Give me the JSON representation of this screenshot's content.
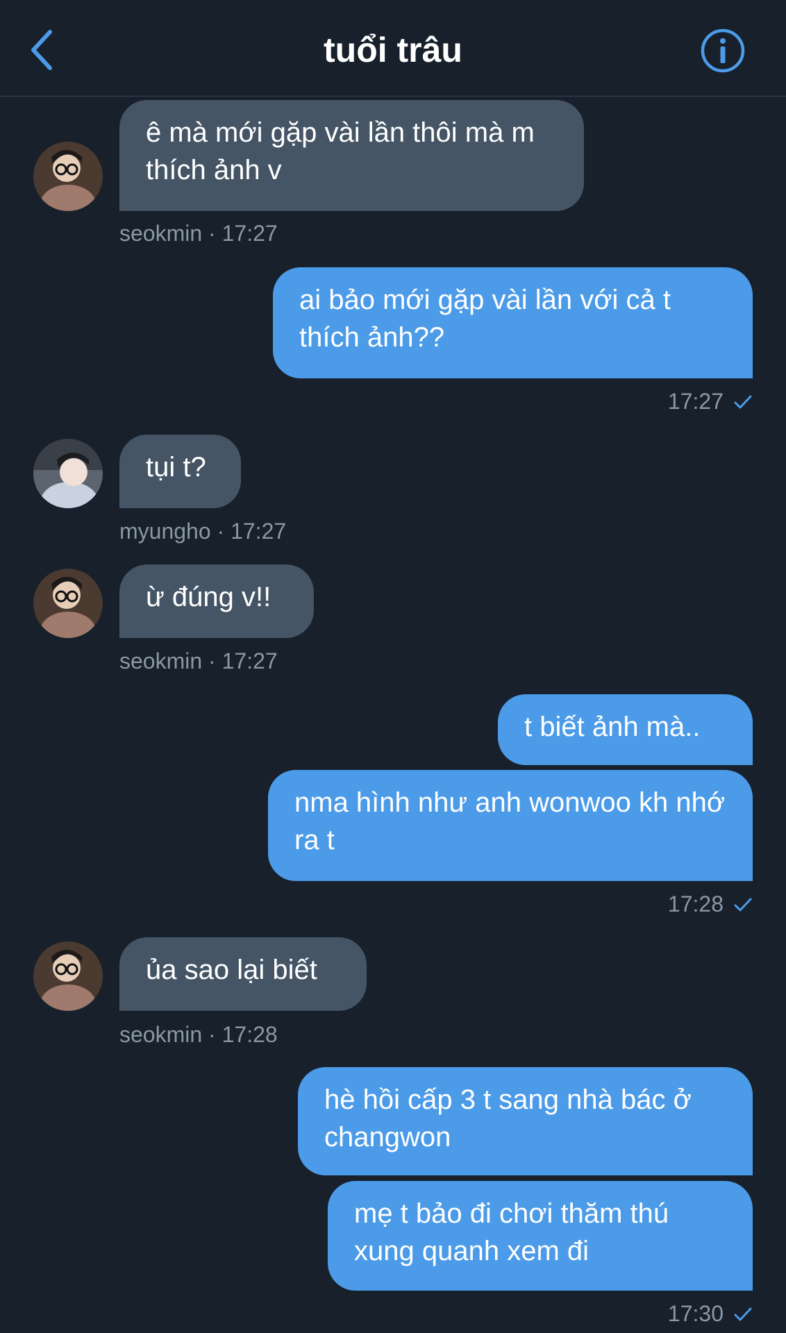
{
  "header": {
    "title": "tuổi trâu",
    "back_icon": "chevron-left-icon",
    "info_icon": "info-icon"
  },
  "colors": {
    "background": "#17202b",
    "incoming_bubble": "#455566",
    "outgoing_bubble": "#4c9be8",
    "accent": "#4c9be8",
    "meta_text": "#8b98a5"
  },
  "messages": [
    {
      "direction": "in",
      "text": "ê mà mới gặp vài lần thôi mà m thích ảnh v"
    },
    {
      "direction": "in_meta",
      "sender": "seokmin",
      "time": "17:27"
    },
    {
      "direction": "out",
      "text": "ai bảo mới gặp vài lần với cả t thích ảnh??"
    },
    {
      "direction": "out_meta",
      "time": "17:27"
    },
    {
      "direction": "in",
      "text": "tụi t?"
    },
    {
      "direction": "in_meta",
      "sender": "myungho",
      "time": "17:27"
    },
    {
      "direction": "in",
      "text": "ừ đúng v!!"
    },
    {
      "direction": "in_meta",
      "sender": "seokmin",
      "time": "17:27"
    },
    {
      "direction": "out",
      "text": "t biết ảnh mà.."
    },
    {
      "direction": "out",
      "text": "nma hình như anh wonwoo kh nhớ ra t"
    },
    {
      "direction": "out_meta",
      "time": "17:28"
    },
    {
      "direction": "in",
      "text": "ủa sao lại biết"
    },
    {
      "direction": "in_meta",
      "sender": "seokmin",
      "time": "17:28"
    },
    {
      "direction": "out",
      "text": "hè hồi cấp 3 t sang nhà bác ở changwon"
    },
    {
      "direction": "out",
      "text": "mẹ t bảo đi chơi thăm thú xung quanh xem đi"
    },
    {
      "direction": "out_meta",
      "time": "17:30"
    }
  ],
  "meta_separator": "·"
}
